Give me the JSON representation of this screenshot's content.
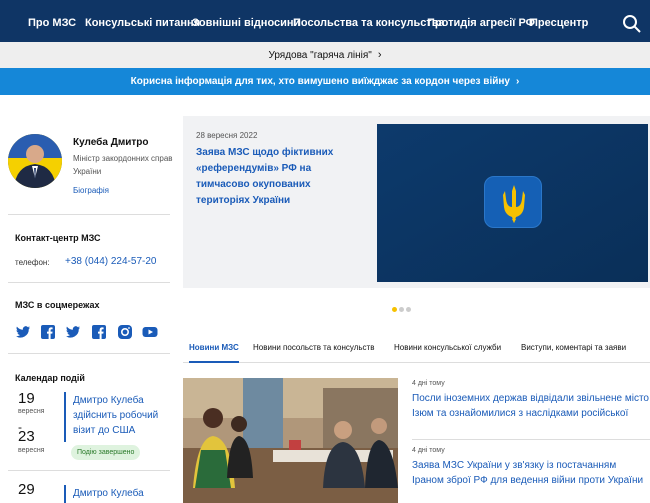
{
  "nav": {
    "items": [
      "Про МЗС",
      "Консульські питання",
      "Зовнішні відносини",
      "Посольства та консульства",
      "Протидія агресії РФ",
      "Пресцентр"
    ],
    "search_icon": "search-icon"
  },
  "hotline": {
    "label": "Урядова \"гаряча лінія\""
  },
  "banner": {
    "label": "Корисна інформація для тих, хто вимушено виїжджає за кордон через війну"
  },
  "minister": {
    "name": "Кулеба Дмитро",
    "role": "Міністр закордонних справ України",
    "bio_link": "Біографія"
  },
  "contact": {
    "title": "Контакт-центр МЗС",
    "phone_label": "телефон:",
    "phone": "+38 (044) 224-57-20"
  },
  "social": {
    "title": "МЗС в соцмережах",
    "icons": [
      "twitter-icon",
      "facebook-icon",
      "twitter-icon",
      "facebook-icon",
      "instagram-icon",
      "youtube-icon"
    ]
  },
  "calendar": {
    "title": "Календар подій",
    "events": [
      {
        "day_start": "19",
        "month_start": "вересня",
        "day_end": "23",
        "month_end": "вересня",
        "title": "Дмитро Кулеба здійснить робочий візит до США",
        "badge": "Подію завершено"
      },
      {
        "day_start": "29",
        "title": "Дмитро Кулеба"
      }
    ]
  },
  "hero": {
    "date": "28 вересня 2022",
    "title": "Заява МЗС щодо фіктивних «референдумів» РФ на тимчасово окупованих територіях України"
  },
  "tabs": [
    "Новини МЗС",
    "Новини посольств та консульств",
    "Новини консульської служби",
    "Виступи, коментарі та заяви"
  ],
  "news": [
    {
      "time": "4 дні тому",
      "title": "Посли іноземних держав відвідали звільнене місто Ізюм та ознайомилися з наслідками російської окупації"
    },
    {
      "time": "4 дні тому",
      "title": "Заява МЗС України у зв'язку із постачанням Іраном зброї РФ для ведення війни проти України"
    }
  ],
  "colors": {
    "nav_bg": "#0f3565",
    "banner_bg": "#1587d8",
    "link": "#1a5bb8",
    "accent": "#f6c100"
  }
}
